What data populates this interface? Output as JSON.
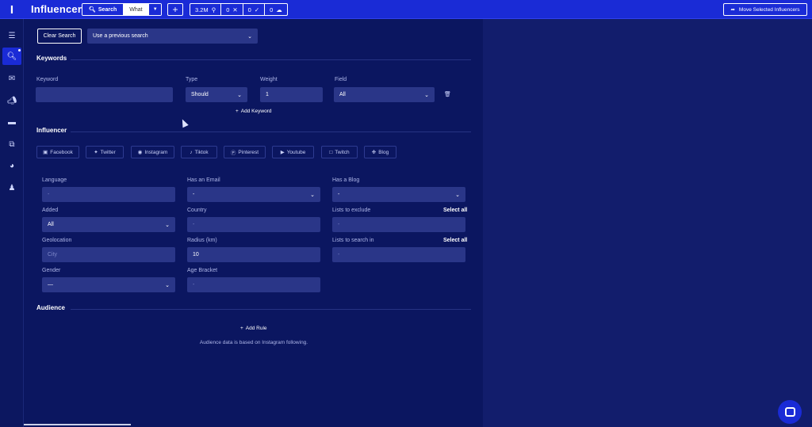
{
  "app": {
    "title": "Influencers",
    "logo": "I"
  },
  "toolbar": {
    "search_label": "Search",
    "what_label": "What",
    "stats": [
      {
        "value": "3.2M",
        "icon": "search-icon"
      },
      {
        "value": "0",
        "icon": "close-icon"
      },
      {
        "value": "0",
        "icon": "check-icon"
      },
      {
        "value": "0",
        "icon": "cloud-icon"
      }
    ],
    "move_label": "Move Selected Influencers"
  },
  "sidebar": {
    "items": [
      "list-icon",
      "search-icon",
      "inbox-icon",
      "megaphone-icon",
      "cards-icon",
      "share-icon",
      "pie-chart-icon",
      "team-icon"
    ]
  },
  "search": {
    "clear_label": "Clear Search",
    "previous_placeholder": "Use a previous search"
  },
  "keywords": {
    "heading": "Keywords",
    "keyword_label": "Keyword",
    "keyword_value": "",
    "type_label": "Type",
    "type_value": "Should",
    "weight_label": "Weight",
    "weight_value": "1",
    "field_label": "Field",
    "field_value": "All",
    "add_label": "Add Keyword"
  },
  "influencer": {
    "heading": "Influencer",
    "platforms": [
      "Facebook",
      "Twitter",
      "Instagram",
      "Tiktok",
      "Pinterest",
      "Youtube",
      "Twitch",
      "Blog"
    ],
    "language": {
      "label": "Language",
      "value": "-"
    },
    "has_email": {
      "label": "Has an Email",
      "value": "-"
    },
    "has_blog": {
      "label": "Has a Blog",
      "value": "-"
    },
    "added": {
      "label": "Added",
      "value": "All"
    },
    "country": {
      "label": "Country",
      "value": "-"
    },
    "lists_exclude": {
      "label": "Lists to exclude",
      "value": "-",
      "select_all": "Select all"
    },
    "geolocation": {
      "label": "Geolocation",
      "placeholder": "City"
    },
    "radius": {
      "label": "Radius (km)",
      "value": "10"
    },
    "lists_search": {
      "label": "Lists to search in",
      "value": "-",
      "select_all": "Select all"
    },
    "gender": {
      "label": "Gender",
      "value": "—"
    },
    "age": {
      "label": "Age Bracket",
      "value": "-"
    }
  },
  "audience": {
    "heading": "Audience",
    "add_label": "Add Rule",
    "note": "Audience data is based on Instagram following."
  }
}
